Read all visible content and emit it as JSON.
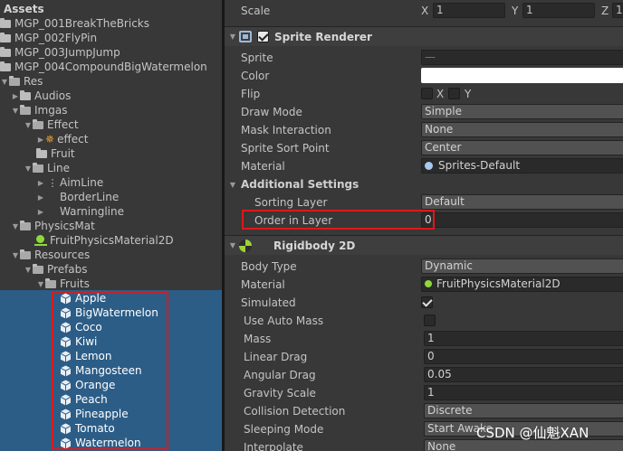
{
  "project": {
    "header": "Assets",
    "rows": [
      {
        "label": "MGP_001BreakTheBricks"
      },
      {
        "label": "MGP_002FlyPin"
      },
      {
        "label": "MGP_003JumpJump"
      },
      {
        "label": "MGP_004CompoundBigWatermelon"
      },
      {
        "label": "Res"
      },
      {
        "label": "Audios"
      },
      {
        "label": "Imgas"
      },
      {
        "label": "Effect"
      },
      {
        "label": "effect"
      },
      {
        "label": "Fruit"
      },
      {
        "label": "Line"
      },
      {
        "label": "AimLine"
      },
      {
        "label": "BorderLine"
      },
      {
        "label": "Warningline"
      },
      {
        "label": "PhysicsMat"
      },
      {
        "label": "FruitPhysicsMaterial2D"
      },
      {
        "label": "Resources"
      },
      {
        "label": "Prefabs"
      },
      {
        "label": "Fruits"
      },
      {
        "label": "Apple"
      },
      {
        "label": "BigWatermelon"
      },
      {
        "label": "Coco"
      },
      {
        "label": "Kiwi"
      },
      {
        "label": "Lemon"
      },
      {
        "label": "Mangosteen"
      },
      {
        "label": "Orange"
      },
      {
        "label": "Peach"
      },
      {
        "label": "Pineapple"
      },
      {
        "label": "Tomato"
      },
      {
        "label": "Watermelon"
      }
    ]
  },
  "inspector": {
    "scale": {
      "label": "Scale",
      "x_axis": "X",
      "x": "1",
      "y_axis": "Y",
      "y": "1",
      "z_axis": "Z",
      "z": "1"
    },
    "sprite_renderer": {
      "title": "Sprite Renderer",
      "sprite_label": "Sprite",
      "sprite_value": "—",
      "color_label": "Color",
      "flip_label": "Flip",
      "flip_x": "X",
      "flip_y": "Y",
      "draw_mode_label": "Draw Mode",
      "draw_mode_value": "Simple",
      "mask_label": "Mask Interaction",
      "mask_value": "None",
      "sort_point_label": "Sprite Sort Point",
      "sort_point_value": "Center",
      "material_label": "Material",
      "material_value": "Sprites-Default",
      "additional_label": "Additional Settings",
      "sorting_layer_label": "Sorting Layer",
      "sorting_layer_value": "Default",
      "order_label": "Order in Layer",
      "order_value": "0"
    },
    "rigidbody": {
      "title": "Rigidbody 2D",
      "body_type_label": "Body Type",
      "body_type_value": "Dynamic",
      "material_label": "Material",
      "material_value": "FruitPhysicsMaterial2D",
      "simulated_label": "Simulated",
      "auto_mass_label": "Use Auto Mass",
      "mass_label": "Mass",
      "mass_value": "1",
      "linear_drag_label": "Linear Drag",
      "linear_drag_value": "0",
      "angular_drag_label": "Angular Drag",
      "angular_drag_value": "0.05",
      "gravity_label": "Gravity Scale",
      "gravity_value": "1",
      "collision_label": "Collision Detection",
      "collision_value": "Discrete",
      "sleeping_label": "Sleeping Mode",
      "sleeping_value": "Start Awake",
      "interpolate_label": "Interpolate",
      "interpolate_value": "None"
    },
    "watermark": "CSDN @仙魁XAN"
  }
}
